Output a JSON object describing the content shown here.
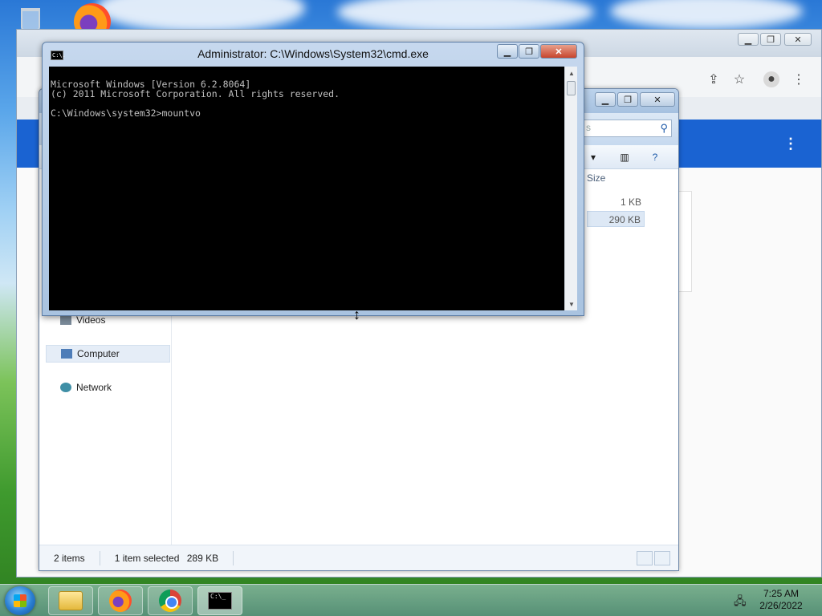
{
  "desktop": {
    "recycle_bin_label": "Recycle Bin",
    "firefox_label": "Firefox"
  },
  "browser": {
    "share_icon": "share-icon",
    "bookmark_icon": "star-icon",
    "profile_icon": "profile-icon",
    "menu_icon": "kebab-menu-icon"
  },
  "explorer": {
    "search_placeholder": "s",
    "column_size": "Size",
    "files": [
      {
        "size": "1 KB",
        "selected": false
      },
      {
        "size": "290 KB",
        "selected": true
      }
    ],
    "nav": {
      "videos": "Videos",
      "computer": "Computer",
      "network": "Network"
    },
    "status": {
      "count": "2 items",
      "selection": "1 item selected",
      "size": "289 KB"
    }
  },
  "cmd": {
    "title": "Administrator: C:\\Windows\\System32\\cmd.exe",
    "icon_text": "C:\\.",
    "lines": [
      "Microsoft Windows [Version 6.2.8064]",
      "(c) 2011 Microsoft Corporation. All rights reserved.",
      "",
      "C:\\Windows\\system32>mountvo"
    ]
  },
  "taskbar": {
    "items": [
      "Windows Explorer",
      "Firefox",
      "Google Chrome",
      "Command Prompt"
    ],
    "time": "7:25 AM",
    "date": "2/26/2022"
  }
}
